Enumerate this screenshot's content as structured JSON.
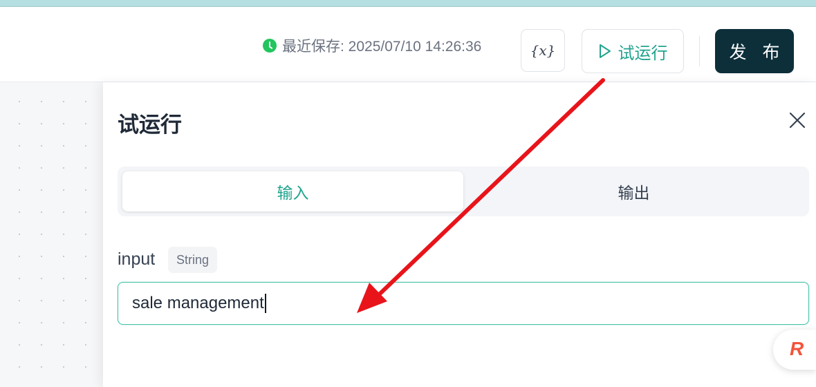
{
  "header": {
    "save_status": "最近保存: 2025/07/10 14:26:36",
    "variables_label": "{x}",
    "run_label": "试运行",
    "publish_label": "发 布"
  },
  "panel": {
    "title": "试运行",
    "tabs": [
      {
        "label": "输入",
        "active": true
      },
      {
        "label": "输出",
        "active": false
      }
    ],
    "field": {
      "label": "input",
      "type": "String",
      "value": "sale management"
    }
  },
  "colors": {
    "accent": "#20a38e",
    "publish_bg": "#0d2f3a",
    "save_dot": "#22c55e",
    "annotation_arrow": "#e8141a"
  },
  "icons": [
    "clock-icon",
    "variables-icon",
    "play-icon",
    "close-icon",
    "brand-logo-icon"
  ]
}
